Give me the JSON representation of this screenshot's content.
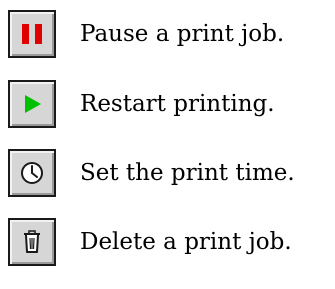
{
  "legend": {
    "items": [
      {
        "icon": "pause-icon",
        "label": "Pause a print job.",
        "icon_color": "#e00000"
      },
      {
        "icon": "play-icon",
        "label": "Restart printing.",
        "icon_color": "#00c000"
      },
      {
        "icon": "clock-icon",
        "label": "Set the print time.",
        "icon_color": "#1a1a1a"
      },
      {
        "icon": "trash-icon",
        "label": "Delete a print job.",
        "icon_color": "#1a1a1a"
      }
    ]
  },
  "colors": {
    "button_face": "#d6d6d6",
    "button_border": "#1a1a1a",
    "text": "#000000",
    "background": "#ffffff"
  }
}
